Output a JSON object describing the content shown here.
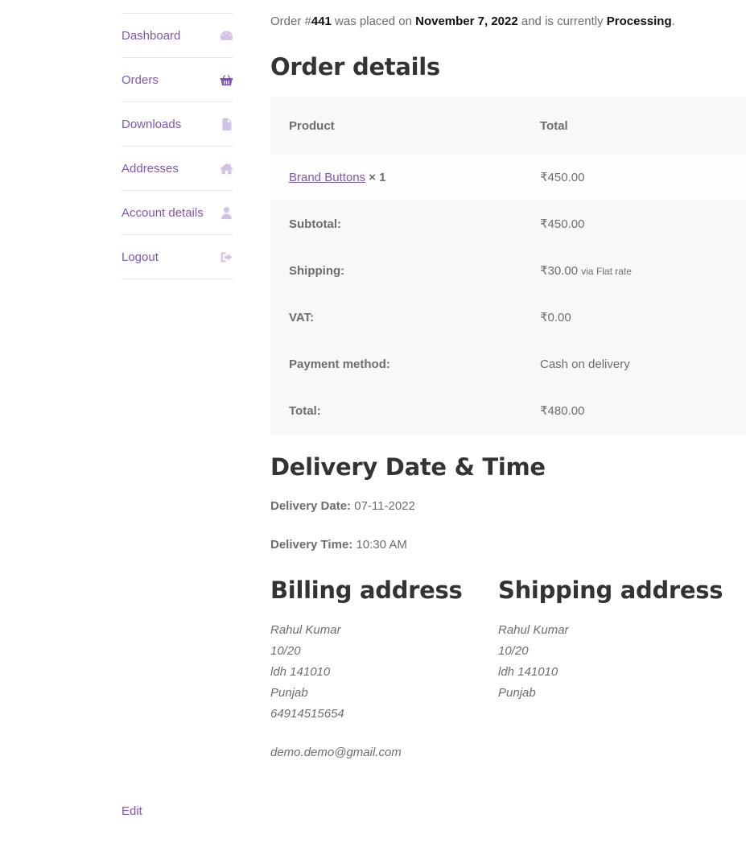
{
  "nav": {
    "items": [
      {
        "label": "Dashboard",
        "icon": "dashboard-icon"
      },
      {
        "label": "Orders",
        "icon": "basket-icon",
        "active": true
      },
      {
        "label": "Downloads",
        "icon": "file-icon"
      },
      {
        "label": "Addresses",
        "icon": "home-icon"
      },
      {
        "label": "Account details",
        "icon": "user-icon"
      },
      {
        "label": "Logout",
        "icon": "sign-out-icon"
      }
    ]
  },
  "order": {
    "notice_prefix": "Order #",
    "number": "441",
    "notice_mid": " was placed on ",
    "date": "November 7, 2022",
    "notice_mid2": " and is currently ",
    "status": "Processing",
    "notice_end": "."
  },
  "order_details": {
    "title": "Order details",
    "headers": {
      "product": "Product",
      "total": "Total"
    },
    "item": {
      "name": "Brand Buttons",
      "qty": "× 1",
      "total": "₹450.00"
    },
    "totals": [
      {
        "label": "Subtotal:",
        "value": "₹450.00",
        "note": ""
      },
      {
        "label": "Shipping:",
        "value": "₹30.00",
        "note": "via Flat rate"
      },
      {
        "label": "VAT:",
        "value": "₹0.00",
        "note": ""
      },
      {
        "label": "Payment method:",
        "value": "Cash on delivery",
        "note": ""
      },
      {
        "label": "Total:",
        "value": "₹480.00",
        "note": ""
      }
    ]
  },
  "delivery": {
    "title": "Delivery Date & Time",
    "date_label": "Delivery Date:",
    "date_value": "07-11-2022",
    "time_label": "Delivery Time:",
    "time_value": "10:30 AM"
  },
  "billing": {
    "title": "Billing address",
    "lines": [
      "Rahul Kumar",
      "10/20",
      "ldh 141010",
      "Punjab",
      "64914515654"
    ],
    "email": "demo.demo@gmail.com"
  },
  "shipping": {
    "title": "Shipping address",
    "lines": [
      "Rahul Kumar",
      "10/20",
      "ldh 141010",
      "Punjab"
    ]
  },
  "footer": {
    "edit_label": "Edit"
  },
  "colors": {
    "accent": "#7f54b3",
    "text": "#6d6d6d",
    "heading": "#333333",
    "table_bg": "#f8f8f8"
  }
}
